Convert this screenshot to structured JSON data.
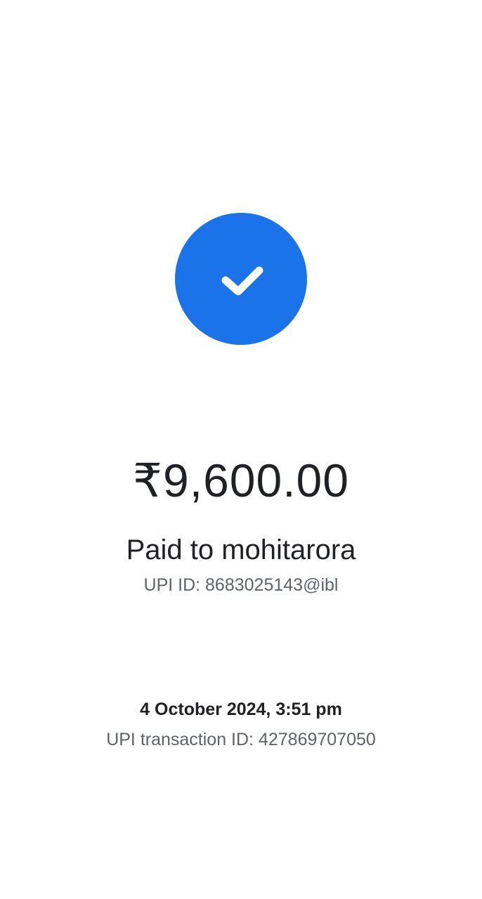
{
  "status": {
    "icon": "check-icon",
    "color": "#1a73e8"
  },
  "payment": {
    "amount": "₹9,600.00",
    "paid_to": "Paid to mohitarora",
    "upi_id": "UPI ID: 8683025143@ibl"
  },
  "transaction": {
    "datetime": "4 October 2024, 3:51 pm",
    "upi_transaction_id": "UPI transaction ID: 427869707050"
  }
}
